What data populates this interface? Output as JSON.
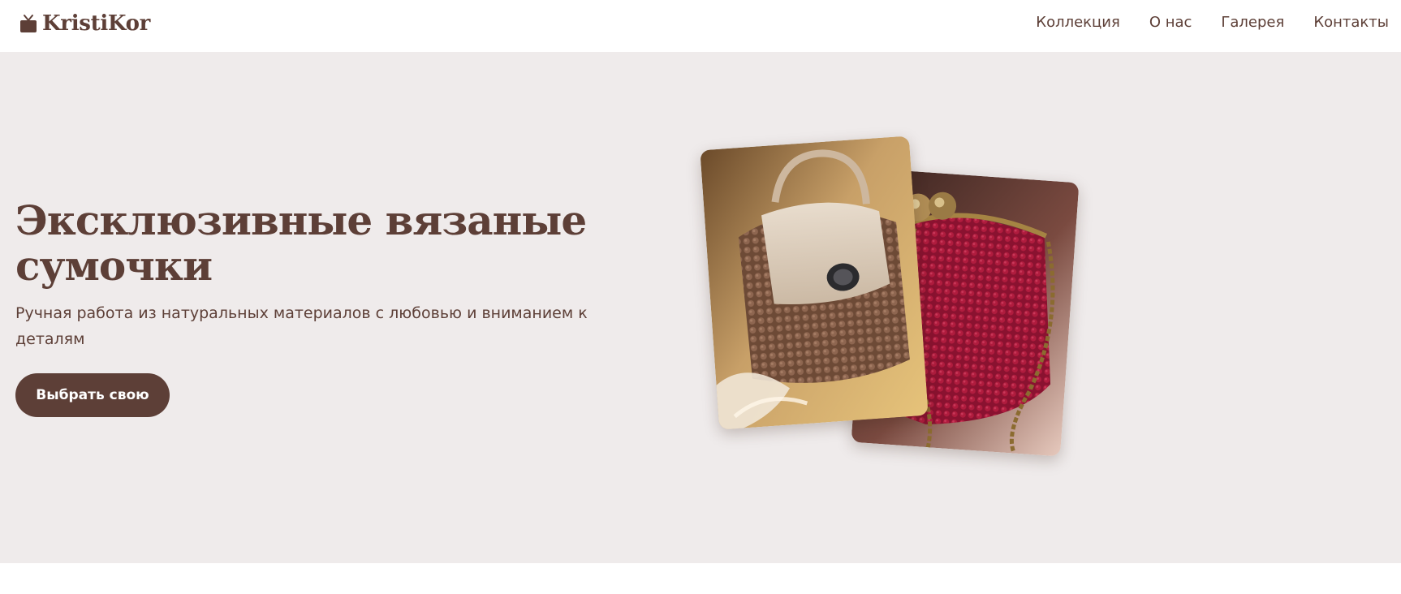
{
  "header": {
    "logo_text": "KristiKor",
    "logo_icon": "tv-icon",
    "nav": [
      {
        "label": "Коллекция"
      },
      {
        "label": "О нас"
      },
      {
        "label": "Галерея"
      },
      {
        "label": "Контакты"
      }
    ]
  },
  "hero": {
    "title": "Эксклюзивные вязаные сумочки",
    "subtitle": "Ручная работа из натуральных материалов с любовью и вниманием к деталям",
    "cta_label": "Выбрать свою",
    "images": [
      {
        "name": "brown-knitted-bag-photo"
      },
      {
        "name": "burgundy-knitted-clutch-photo"
      }
    ]
  },
  "colors": {
    "brand": "#5d3f37",
    "hero_background": "#efebeb",
    "header_background": "#ffffff",
    "button_text": "#ffffff"
  }
}
